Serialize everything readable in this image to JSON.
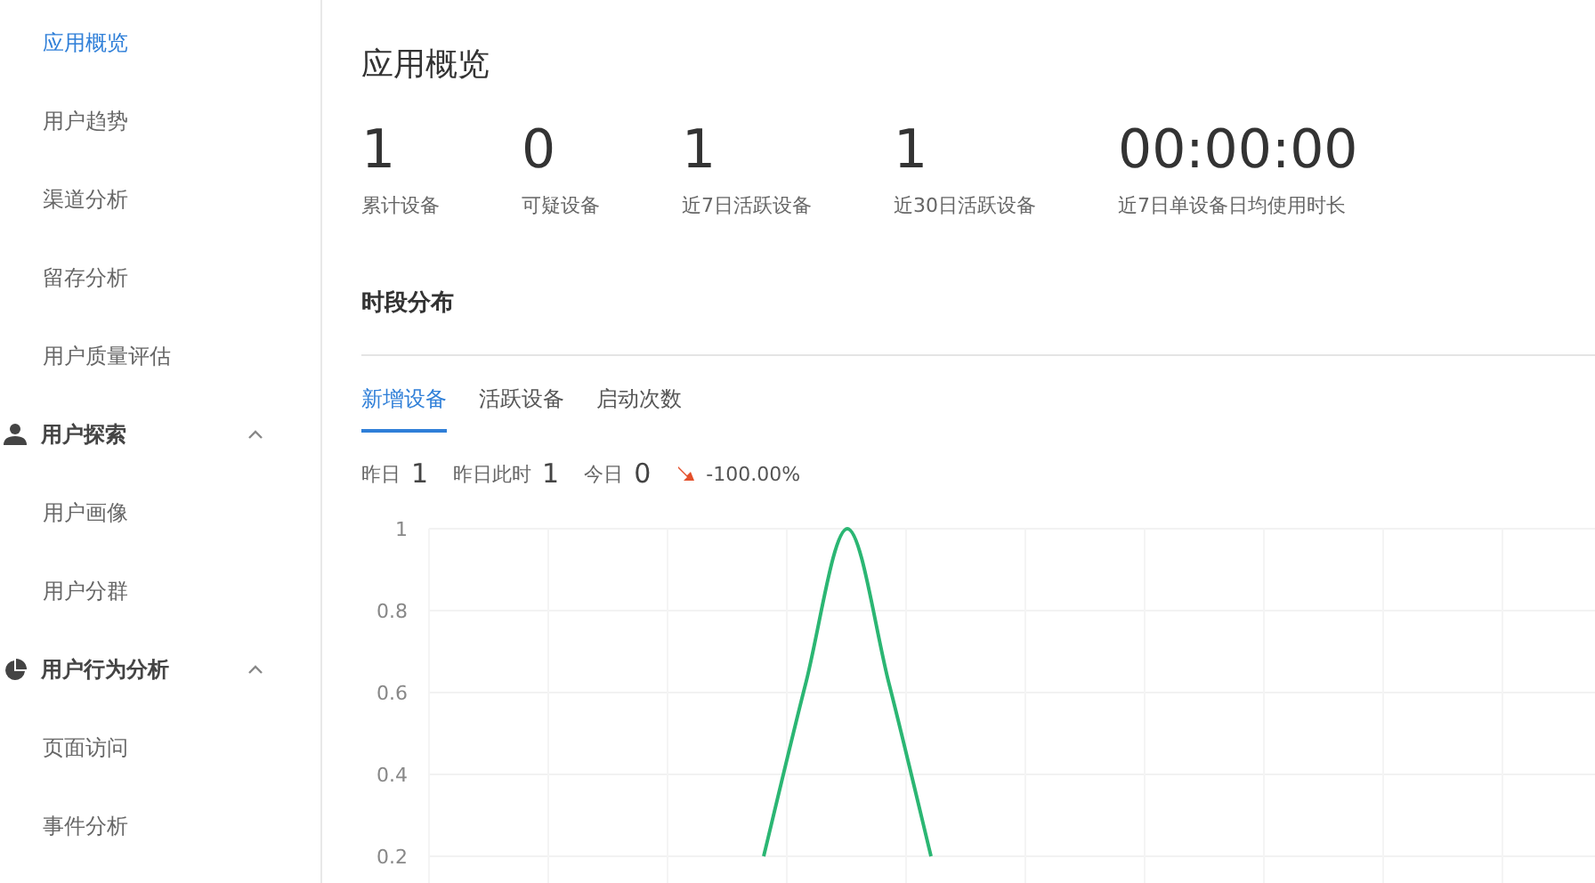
{
  "sidebar": {
    "items": [
      {
        "kind": "link",
        "label": "应用概览",
        "selected": true
      },
      {
        "kind": "link",
        "label": "用户趋势",
        "selected": false
      },
      {
        "kind": "link",
        "label": "渠道分析",
        "selected": false
      },
      {
        "kind": "link",
        "label": "留存分析",
        "selected": false
      },
      {
        "kind": "link",
        "label": "用户质量评估",
        "selected": false
      },
      {
        "kind": "group",
        "label": "用户探索",
        "expanded": true,
        "children": [
          {
            "label": "用户画像",
            "selected": false
          },
          {
            "label": "用户分群",
            "selected": false
          }
        ]
      },
      {
        "kind": "group",
        "label": "用户行为分析",
        "expanded": true,
        "children": [
          {
            "label": "页面访问",
            "selected": false
          },
          {
            "label": "事件分析",
            "selected": false
          }
        ]
      }
    ]
  },
  "page_title": "应用概览",
  "stats": [
    {
      "value": "1",
      "label": "累计设备"
    },
    {
      "value": "0",
      "label": "可疑设备"
    },
    {
      "value": "1",
      "label": "近7日活跃设备"
    },
    {
      "value": "1",
      "label": "近30日活跃设备"
    },
    {
      "value": "00:00:00",
      "label": "近7日单设备日均使用时长"
    }
  ],
  "section_title": "时段分布",
  "tabs": [
    {
      "label": "新增设备",
      "selected": true
    },
    {
      "label": "活跃设备",
      "selected": false
    },
    {
      "label": "启动次数",
      "selected": false
    }
  ],
  "summary": [
    {
      "label": "昨日",
      "value": "1"
    },
    {
      "label": "昨日此时",
      "value": "1"
    },
    {
      "label": "今日",
      "value": "0"
    }
  ],
  "change": {
    "decrease": true,
    "text": "-100.00%"
  },
  "chart_data": {
    "type": "line",
    "grid": true,
    "ylim": [
      0,
      1
    ],
    "yticks": [
      1,
      0.8,
      0.6,
      0.4,
      0.2
    ],
    "series": [
      {
        "color": "#2bb673",
        "values": [
          null,
          null,
          null,
          null,
          null,
          null,
          null,
          null,
          0.2,
          0.62,
          1,
          0.62,
          0.2,
          null,
          null,
          null,
          null,
          null,
          null,
          null,
          null,
          null,
          null,
          null,
          null,
          null,
          null,
          null,
          null
        ]
      }
    ]
  }
}
